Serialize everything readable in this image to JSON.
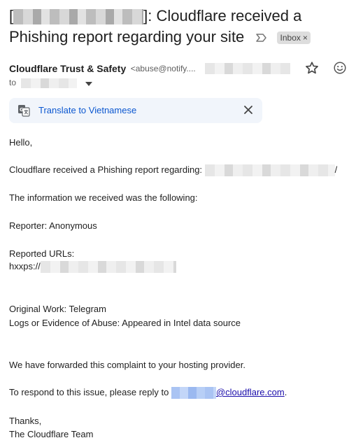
{
  "email": {
    "subject_prefix": "[",
    "subject_suffix": "]: Cloudflare received a",
    "subject_line2": "Phishing report regarding your site",
    "label_chip": "Inbox",
    "label_close": "×"
  },
  "sender": {
    "name": "Cloudflare Trust & Safety",
    "email": "<abuse@notify...."
  },
  "recipient": {
    "to_label": "to"
  },
  "translate": {
    "link_text": "Translate to Vietnamese"
  },
  "body": {
    "greeting": "Hello,",
    "received_prefix": "Cloudflare received a Phishing report regarding: ",
    "received_suffix": "/",
    "info_line": "The information we received was the following:",
    "reporter": "Reporter: Anonymous",
    "reported_urls_label": "Reported URLs:",
    "url_prefix": "hxxps://",
    "original_work": "Original Work: Telegram",
    "logs_evidence": "Logs or Evidence of Abuse: Appeared in Intel data source",
    "forwarded": "We have forwarded this complaint to your hosting provider.",
    "respond_prefix": "To respond to this issue, please reply to ",
    "respond_email_domain": "@cloudflare.com",
    "respond_suffix": ".",
    "thanks": "Thanks,",
    "signature": "The Cloudflare Team"
  },
  "icons": {
    "translate": "google-translate-icon",
    "close": "close-icon",
    "star": "star-icon",
    "emoji": "emoji-reaction-icon",
    "important": "importance-marker-icon",
    "dropdown": "chevron-down-icon"
  }
}
